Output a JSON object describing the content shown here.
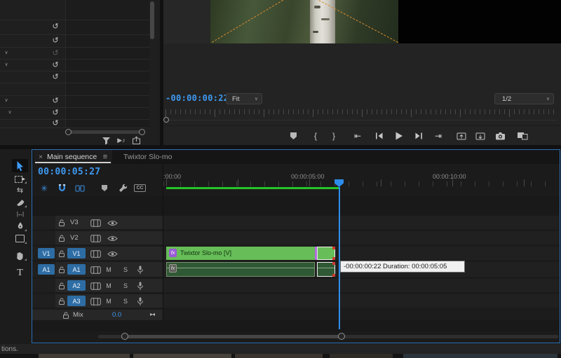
{
  "program_monitor": {
    "timecode": "-00:00:00:22",
    "zoom_select": "Fit",
    "playback_resolution": "1/2"
  },
  "timeline": {
    "tabs": [
      {
        "label": "Main sequence"
      },
      {
        "label": "Twixtor Slo-mo"
      }
    ],
    "timecode": "00:00:05:27",
    "ruler_labels": [
      ":00:00",
      "00:00:05:00",
      "00:00:10:00"
    ],
    "toolbar": {
      "captions_label": "CC"
    },
    "tracks": {
      "v3": {
        "name": "V3"
      },
      "v2": {
        "name": "V2"
      },
      "v1": {
        "name": "V1",
        "source": "V1"
      },
      "a1": {
        "name": "A1",
        "source": "A1"
      },
      "a2": {
        "name": "A2"
      },
      "a3": {
        "name": "A3"
      },
      "mix": {
        "name": "Mix",
        "value": "0.0"
      },
      "mute": "M",
      "solo": "S"
    },
    "clips": {
      "video_label": "Twixtor Slo-mo [V]",
      "fx": "fx"
    },
    "tooltip": "-00:00:00:22 Duration: 00:00:05:05"
  },
  "status_bar": {
    "text": "tions."
  },
  "icons": {
    "reset": "↺",
    "collapse_chevron": "∨",
    "close": "×",
    "panel_menu": "≡",
    "mark_in": "{",
    "mark_out": "}",
    "go_to_in": "⇤",
    "go_to_out": "⇥",
    "nest_toggle": "✳",
    "play_audio_note": "▶♪",
    "mix_collapse": "▸◂",
    "ripple_tool": "⇆",
    "slip_tool": "|↔|",
    "type_tool": "T",
    "dropdown_chevron": "∨"
  },
  "colors": {
    "accent_blue": "#3e9af2",
    "clip_green": "#67bd58",
    "audio_green": "#2f5834",
    "render_green": "#25c428",
    "fx_purple": "#9a5ad6",
    "selection_red": "#d23b2e",
    "path_orange": "#d88b2e"
  }
}
